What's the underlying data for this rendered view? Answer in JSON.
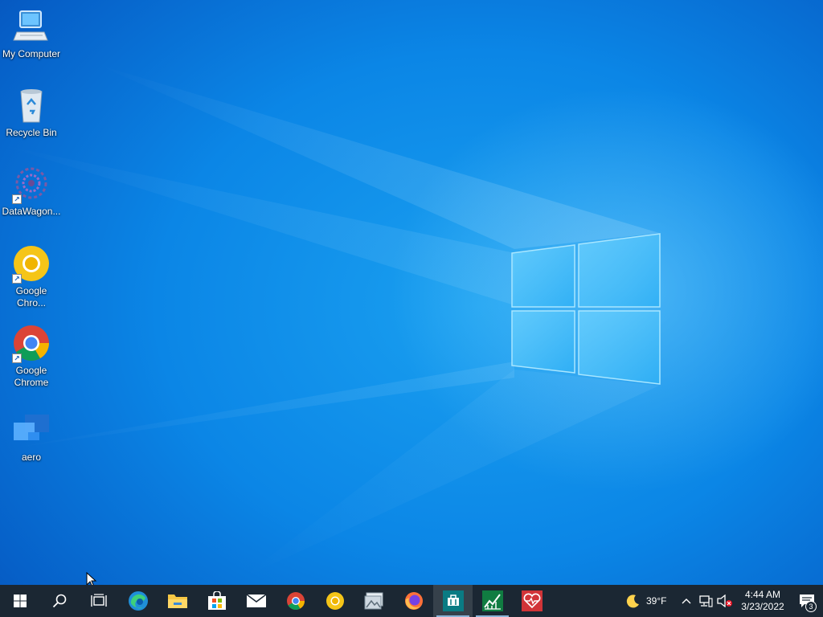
{
  "desktop": {
    "icons": [
      {
        "label": "My Computer",
        "icon": "computer-icon"
      },
      {
        "label": "Recycle Bin",
        "icon": "recycle-bin-icon"
      },
      {
        "label": "DataWagon...",
        "icon": "datawagon-icon"
      },
      {
        "label_line1": "Google",
        "label_line2": "Chro...",
        "icon": "chrome-canary-icon"
      },
      {
        "label_line1": "Google",
        "label_line2": "Chrome",
        "icon": "chrome-icon"
      },
      {
        "label": "aero",
        "icon": "aero-icon"
      }
    ]
  },
  "taskbar": {
    "apps": [
      "start-icon",
      "search-icon",
      "task-view-icon",
      "edge-icon",
      "file-explorer-icon",
      "store-icon",
      "mail-icon",
      "chrome-icon",
      "chrome-canary-icon",
      "photos-icon",
      "firefox-icon",
      "app-teal-icon",
      "stock-chart-icon",
      "health-app-icon"
    ],
    "tray": {
      "weather_icon": "moon-icon",
      "temperature": "39°F",
      "time": "4:44 AM",
      "date": "3/23/2022",
      "notification_count": "3"
    }
  },
  "colors": {
    "taskbar": "#1b2733",
    "desktop_accent": "#0b86e6",
    "running_indicator": "#8ab4d8"
  }
}
